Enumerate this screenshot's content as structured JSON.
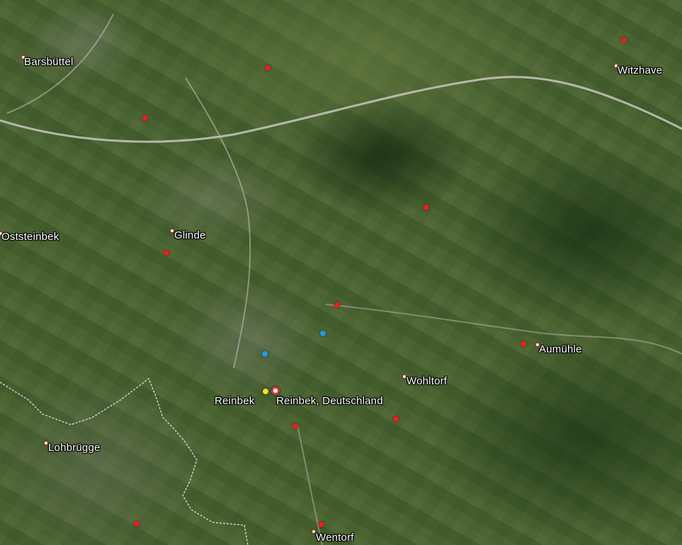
{
  "map": {
    "view": "satellite",
    "colors": {
      "place_dot": "#b02020",
      "marker_red": "#e8201e",
      "marker_blue": "#1e9be8",
      "marker_yellow": "#f2e21a",
      "boundary": "#e6e6f0",
      "road": "#c8c8c0"
    },
    "places": {
      "barsbuettel": "Barsbüttel",
      "witzhave": "Witzhave",
      "oststeinbek": "Oststeinbek",
      "glinde": "Glinde",
      "aumuehle": "Aumühle",
      "wohltorf": "Wohltorf",
      "reinbek": "Reinbek",
      "lohbruegge": "Lohbrügge",
      "wentorf": "Wentorf"
    },
    "search_result": {
      "label": "Reinbek, Deutschland"
    }
  }
}
